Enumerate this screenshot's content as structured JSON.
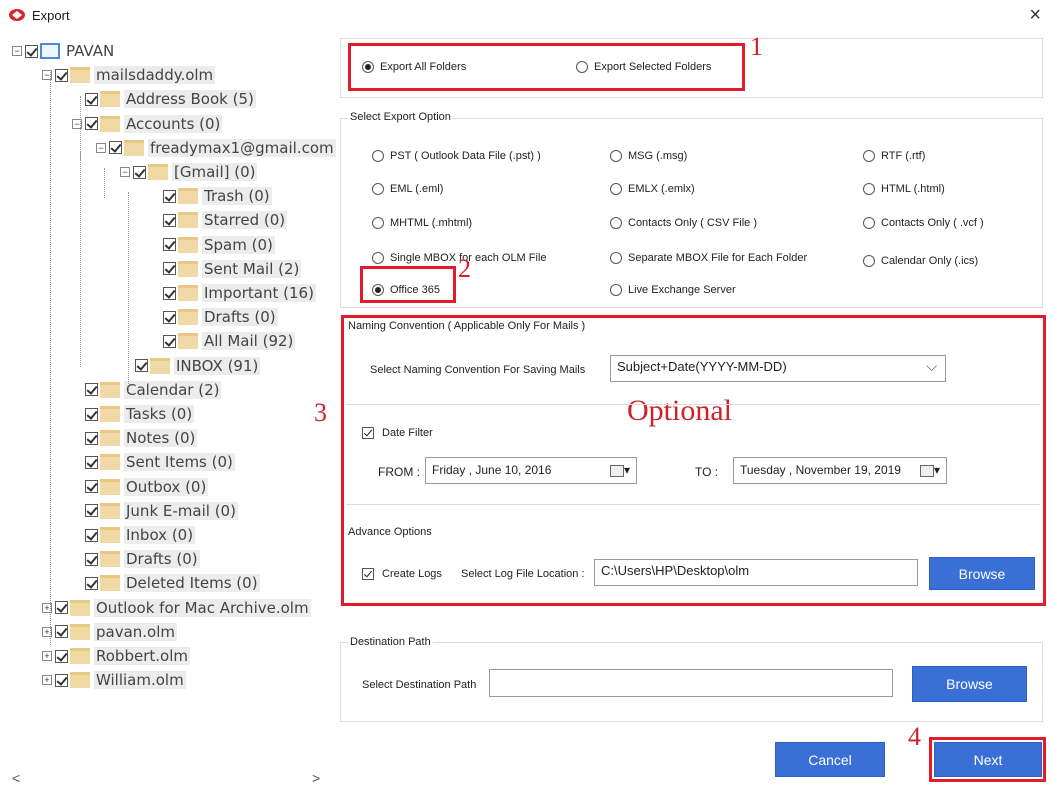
{
  "window": {
    "title": "Export",
    "close": "×"
  },
  "tree": [
    {
      "label": "PAVAN",
      "exp": "⊟",
      "kind": "pc"
    },
    {
      "label": "mailsdaddy.olm",
      "exp": "⊟",
      "kind": "folder"
    },
    {
      "label": "Address Book (5)",
      "exp": "",
      "kind": "folder"
    },
    {
      "label": "Accounts (0)",
      "exp": "⊟",
      "kind": "folder"
    },
    {
      "label": "freadymax1@gmail.com",
      "exp": "⊟",
      "kind": "folder"
    },
    {
      "label": "[Gmail] (0)",
      "exp": "⊟",
      "kind": "folder"
    },
    {
      "label": "Trash (0)",
      "exp": "",
      "kind": "folder"
    },
    {
      "label": "Starred (0)",
      "exp": "",
      "kind": "folder"
    },
    {
      "label": "Spam (0)",
      "exp": "",
      "kind": "folder"
    },
    {
      "label": "Sent Mail (2)",
      "exp": "",
      "kind": "folder"
    },
    {
      "label": "Important (16)",
      "exp": "",
      "kind": "folder"
    },
    {
      "label": "Drafts (0)",
      "exp": "",
      "kind": "folder"
    },
    {
      "label": "All Mail (92)",
      "exp": "",
      "kind": "folder"
    },
    {
      "label": "INBOX (91)",
      "exp": "",
      "kind": "folder"
    },
    {
      "label": "Calendar (2)",
      "exp": "",
      "kind": "folder"
    },
    {
      "label": "Tasks (0)",
      "exp": "",
      "kind": "folder"
    },
    {
      "label": "Notes (0)",
      "exp": "",
      "kind": "folder"
    },
    {
      "label": "Sent Items (0)",
      "exp": "",
      "kind": "folder"
    },
    {
      "label": "Outbox (0)",
      "exp": "",
      "kind": "folder"
    },
    {
      "label": "Junk E-mail (0)",
      "exp": "",
      "kind": "folder"
    },
    {
      "label": "Inbox (0)",
      "exp": "",
      "kind": "folder"
    },
    {
      "label": "Drafts (0)",
      "exp": "",
      "kind": "folder"
    },
    {
      "label": "Deleted Items (0)",
      "exp": "",
      "kind": "folder"
    },
    {
      "label": "Outlook for Mac Archive.olm",
      "exp": "⊞",
      "kind": "folder"
    },
    {
      "label": "pavan.olm",
      "exp": "⊞",
      "kind": "folder"
    },
    {
      "label": "Robbert.olm",
      "exp": "⊞",
      "kind": "folder"
    },
    {
      "label": "William.olm",
      "exp": "⊞",
      "kind": "folder"
    }
  ],
  "scroll": {
    "left": "<",
    "right": ">"
  },
  "export_scope": {
    "all": "Export All Folders",
    "selected": "Export Selected Folders",
    "selected_value": "all"
  },
  "export_option": {
    "title": "Select Export Option",
    "options": [
      "PST ( Outlook Data File (.pst) )",
      "MSG (.msg)",
      "RTF (.rtf)",
      "EML (.eml)",
      "EMLX (.emlx)",
      "HTML (.html)",
      "MHTML (.mhtml)",
      "Contacts Only ( CSV File )",
      "Contacts Only ( .vcf )",
      "Single MBOX for each OLM File",
      "Separate MBOX File for Each Folder",
      "Calendar Only (.ics)",
      "Office 365",
      "Live Exchange Server"
    ],
    "selected": "Office 365"
  },
  "naming": {
    "title": "Naming Convention ( Applicable Only For Mails )",
    "label": "Select Naming Convention For Saving Mails",
    "value": "Subject+Date(YYYY-MM-DD)",
    "chevron": "⌵"
  },
  "optional_text": "Optional",
  "date_filter": {
    "label": "Date Filter",
    "checked": true,
    "from_label": "FROM :",
    "from_value": "Friday    ,    June    10, 2016",
    "to_label": "TO :",
    "to_value": "Tuesday  , November 19, 2019",
    "dropdown": "▾"
  },
  "advance": {
    "title": "Advance Options",
    "create_logs": "Create Logs",
    "create_logs_checked": true,
    "log_label": "Select Log File Location :",
    "log_path": "C:\\Users\\HP\\Desktop\\olm",
    "browse": "Browse"
  },
  "destination": {
    "title": "Destination Path",
    "label": "Select Destination Path",
    "value": "",
    "browse": "Browse"
  },
  "footer": {
    "cancel": "Cancel",
    "next": "Next"
  },
  "annotations": {
    "n1": "1",
    "n2": "2",
    "n3": "3",
    "n4": "4"
  },
  "colors": {
    "accent": "#3a6fd6",
    "annotation": "#e21c2a"
  },
  "icons": {
    "app": "export-app-icon",
    "folder": "folder-icon",
    "computer": "computer-icon"
  }
}
